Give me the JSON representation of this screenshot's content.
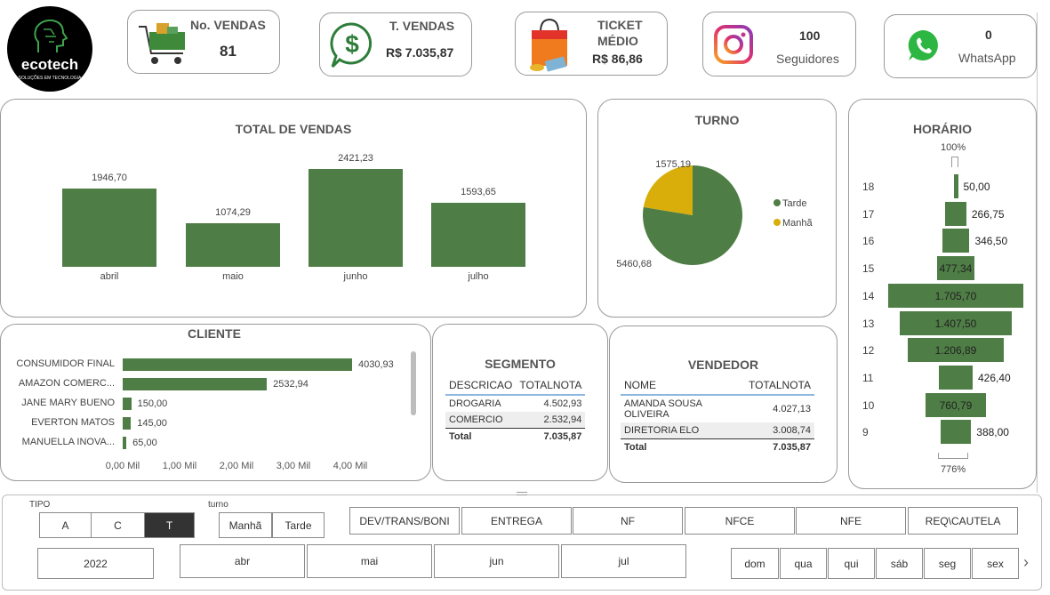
{
  "logo": {
    "name": "ecotech",
    "tagline": "SOLUÇÕES EM TECNOLOGIA"
  },
  "kpis": {
    "vendas": {
      "title": "No. VENDAS",
      "value": "81"
    },
    "tvendas": {
      "title": "T. VENDAS",
      "value": "R$ 7.035,87"
    },
    "ticket": {
      "title1": "TICKET",
      "title2": "MÉDIO",
      "value": "R$ 86,86"
    },
    "instagram": {
      "value": "100",
      "label": "Seguidores"
    },
    "whatsapp": {
      "value": "0",
      "label": "WhatsApp"
    }
  },
  "total_vendas": {
    "title": "TOTAL DE VENDAS"
  },
  "turno": {
    "title": "TURNO",
    "legend": [
      "Tarde",
      "Manhã"
    ]
  },
  "horario": {
    "title": "HORÁRIO",
    "top_label": "100%",
    "bottom_label": "776%"
  },
  "cliente": {
    "title": "CLIENTE"
  },
  "segmento": {
    "title": "SEGMENTO",
    "headers": [
      "DESCRICAO",
      "TOTALNOTA"
    ],
    "rows": [
      [
        "DROGARIA",
        "4.502,93"
      ],
      [
        "COMERCIO",
        "2.532,94"
      ]
    ],
    "total": [
      "Total",
      "7.035,87"
    ]
  },
  "vendedor": {
    "title": "VENDEDOR",
    "headers": [
      "NOME",
      "TOTALNOTA"
    ],
    "rows": [
      [
        "AMANDA SOUSA OLIVEIRA",
        "4.027,13"
      ],
      [
        "DIRETORIA ELO",
        "3.008,74"
      ]
    ],
    "total": [
      "Total",
      "7.035,87"
    ]
  },
  "filters": {
    "tipo_label": "TIPO",
    "tipo": [
      "A",
      "C",
      "T"
    ],
    "turno_label": "turno",
    "turno": [
      "Manhã",
      "Tarde"
    ],
    "categorias": [
      "DEV/TRANS/BONI",
      "ENTREGA",
      "NF",
      "NFCE",
      "NFE",
      "REQ\\CAUTELA"
    ],
    "ano": "2022",
    "meses": [
      "abr",
      "mai",
      "jun",
      "jul"
    ],
    "dias": [
      "dom",
      "qua",
      "qui",
      "sáb",
      "seg",
      "sex"
    ]
  },
  "chart_data": [
    {
      "type": "bar",
      "title": "TOTAL DE VENDAS",
      "categories": [
        "abril",
        "maio",
        "junho",
        "julho"
      ],
      "values": [
        1946.7,
        1074.29,
        2421.23,
        1593.65
      ],
      "value_labels": [
        "1946,70",
        "1074,29",
        "2421,23",
        "1593,65"
      ],
      "ylim": [
        0,
        2500
      ],
      "color": "#4e7d45"
    },
    {
      "type": "pie",
      "title": "TURNO",
      "categories": [
        "Tarde",
        "Manhã"
      ],
      "values": [
        5460.68,
        1575.19
      ],
      "value_labels": [
        "5460,68",
        "1575,19"
      ],
      "colors": [
        "#4e7d45",
        "#d9ae0b"
      ],
      "legend": "right"
    },
    {
      "type": "bar",
      "title": "HORÁRIO",
      "categories": [
        "18",
        "17",
        "16",
        "15",
        "14",
        "13",
        "12",
        "11",
        "10",
        "9"
      ],
      "values": [
        50.0,
        266.75,
        346.5,
        477.34,
        1705.7,
        1407.5,
        1206.89,
        426.4,
        760.79,
        388.0
      ],
      "value_labels": [
        "50,00",
        "266,75",
        "346,50",
        "477,34",
        "1.705,70",
        "1.407,50",
        "1.206,89",
        "426,40",
        "760,79",
        "388,00"
      ],
      "color": "#4e7d45"
    },
    {
      "type": "bar",
      "title": "CLIENTE",
      "categories": [
        "CONSUMIDOR FINAL",
        "AMAZON COMERC...",
        "JANE MARY BUENO",
        "EVERTON MATOS",
        "MANUELLA INOVA..."
      ],
      "values": [
        4030.93,
        2532.94,
        150.0,
        145.0,
        65.0
      ],
      "value_labels": [
        "4030,93",
        "2532,94",
        "150,00",
        "145,00",
        "65,00"
      ],
      "x_ticks": [
        "0,00 Mil",
        "1,00 Mil",
        "2,00 Mil",
        "3,00 Mil",
        "4,00 Mil"
      ],
      "xlim": [
        0,
        4000
      ],
      "color": "#4e7d45"
    }
  ]
}
